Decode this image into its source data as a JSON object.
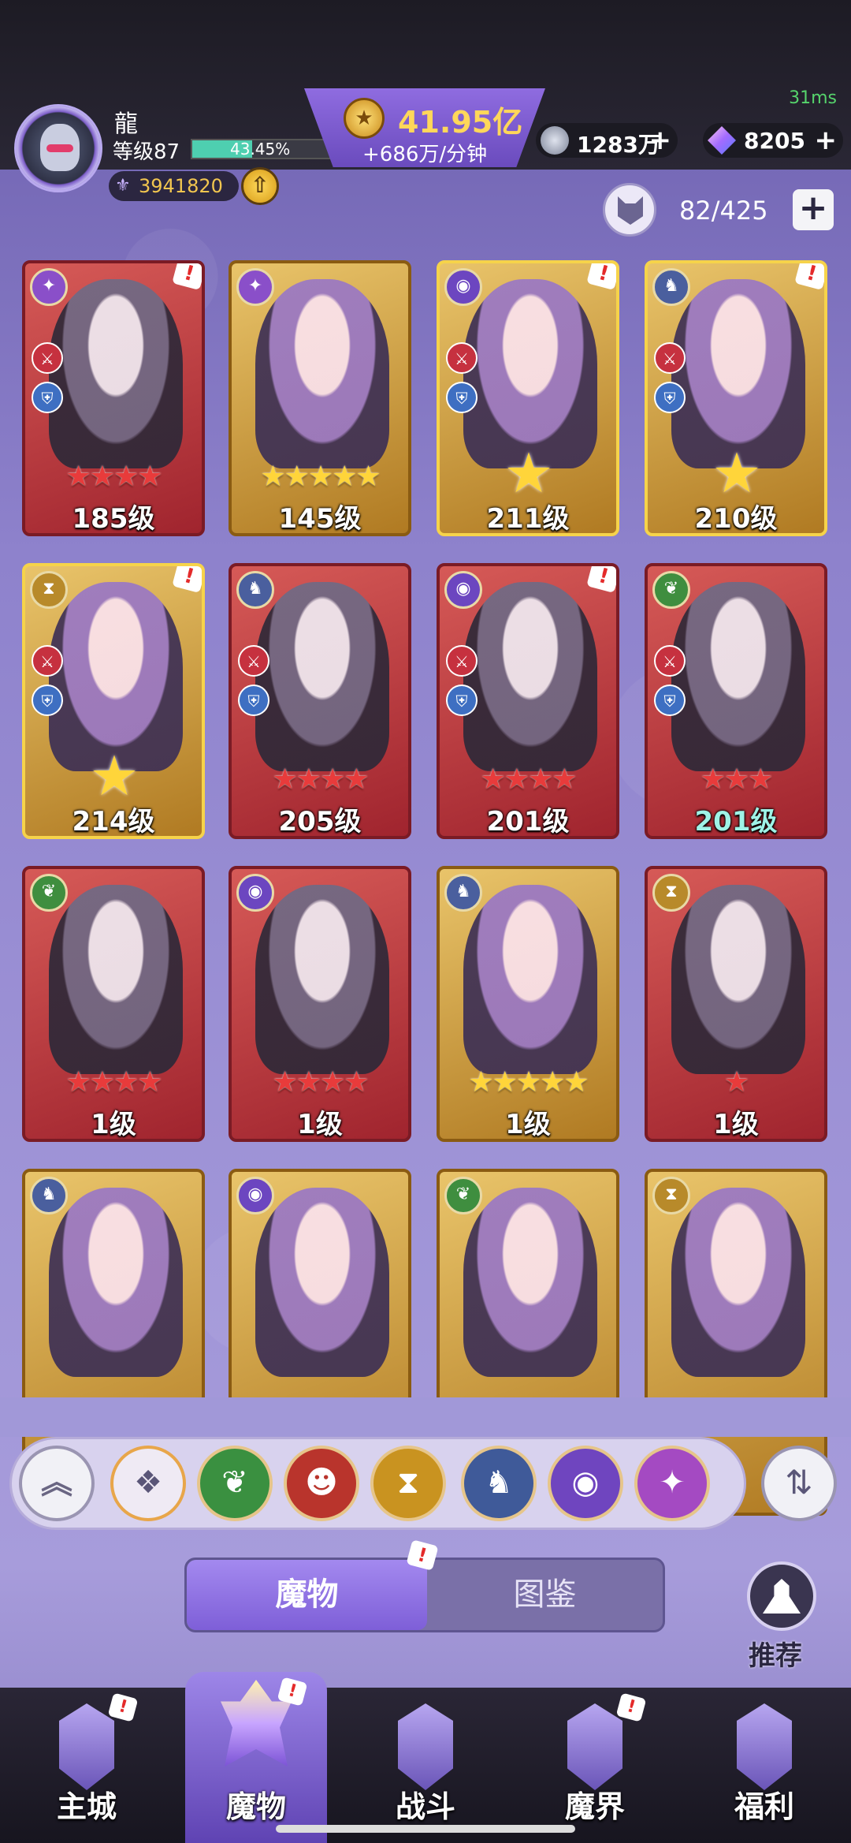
{
  "status": {
    "latency": "31ms"
  },
  "player": {
    "name": "龍",
    "level_label": "等级87",
    "xp_percent_label": "43.45%",
    "xp_fraction": 0.4345,
    "power": "3941820"
  },
  "gold": {
    "value": "41.95亿",
    "rate": "+686万/分钟"
  },
  "resources": {
    "gems": "1283万",
    "crystals": "8205"
  },
  "collection": {
    "count": "82/425"
  },
  "cards": [
    {
      "level": "185级",
      "element": "star",
      "stars": "★★★★",
      "star_color": "red",
      "frame": "red",
      "alert": true
    },
    {
      "level": "145级",
      "element": "star",
      "stars": "★★★★★",
      "star_color": "yellow",
      "frame": "gold",
      "alert": false
    },
    {
      "level": "211级",
      "element": "eye",
      "stars": "★",
      "star_color": "big",
      "frame": "bright",
      "alert": true
    },
    {
      "level": "210级",
      "element": "wolf",
      "stars": "★",
      "star_color": "big",
      "frame": "bright",
      "alert": true
    },
    {
      "level": "214级",
      "element": "hour",
      "stars": "★",
      "star_color": "big",
      "frame": "bright",
      "alert": true
    },
    {
      "level": "205级",
      "element": "wolf",
      "stars": "★★★★",
      "star_color": "red",
      "frame": "red",
      "alert": false
    },
    {
      "level": "201级",
      "element": "eye",
      "stars": "★★★★",
      "star_color": "red",
      "frame": "red",
      "alert": true
    },
    {
      "level": "201级",
      "element": "leaf",
      "stars": "★★★",
      "star_color": "red",
      "frame": "red",
      "alert": false
    },
    {
      "level": "1级",
      "element": "leaf",
      "stars": "★★★★",
      "star_color": "red",
      "frame": "red",
      "alert": false
    },
    {
      "level": "1级",
      "element": "eye",
      "stars": "★★★★",
      "star_color": "red",
      "frame": "red",
      "alert": false
    },
    {
      "level": "1级",
      "element": "wolf",
      "stars": "★★★★★",
      "star_color": "yellow",
      "frame": "gold",
      "alert": false
    },
    {
      "level": "1级",
      "element": "hour",
      "stars": "★",
      "star_color": "red",
      "frame": "red",
      "alert": false
    },
    {
      "level": "",
      "element": "wolf",
      "stars": "★★★★★",
      "star_color": "yellow",
      "frame": "gold",
      "alert": false
    },
    {
      "level": "",
      "element": "eye",
      "stars": "★★★★★",
      "star_color": "yellow",
      "frame": "gold",
      "alert": false
    },
    {
      "level": "",
      "element": "leaf",
      "stars": "★★★★★",
      "star_color": "yellow",
      "frame": "gold",
      "alert": false
    },
    {
      "level": "",
      "element": "hour",
      "stars": "★★★★★",
      "star_color": "yellow",
      "frame": "gold",
      "alert": false
    }
  ],
  "tabs": {
    "active": "魔物",
    "inactive": "图鉴"
  },
  "recommend": {
    "label": "推荐"
  },
  "nav": [
    "主城",
    "魔物",
    "战斗",
    "魔界",
    "福利"
  ],
  "colors": {
    "accent": "#7e5fd8",
    "gold": "#ffd75a",
    "alert": "#e42a2a"
  }
}
